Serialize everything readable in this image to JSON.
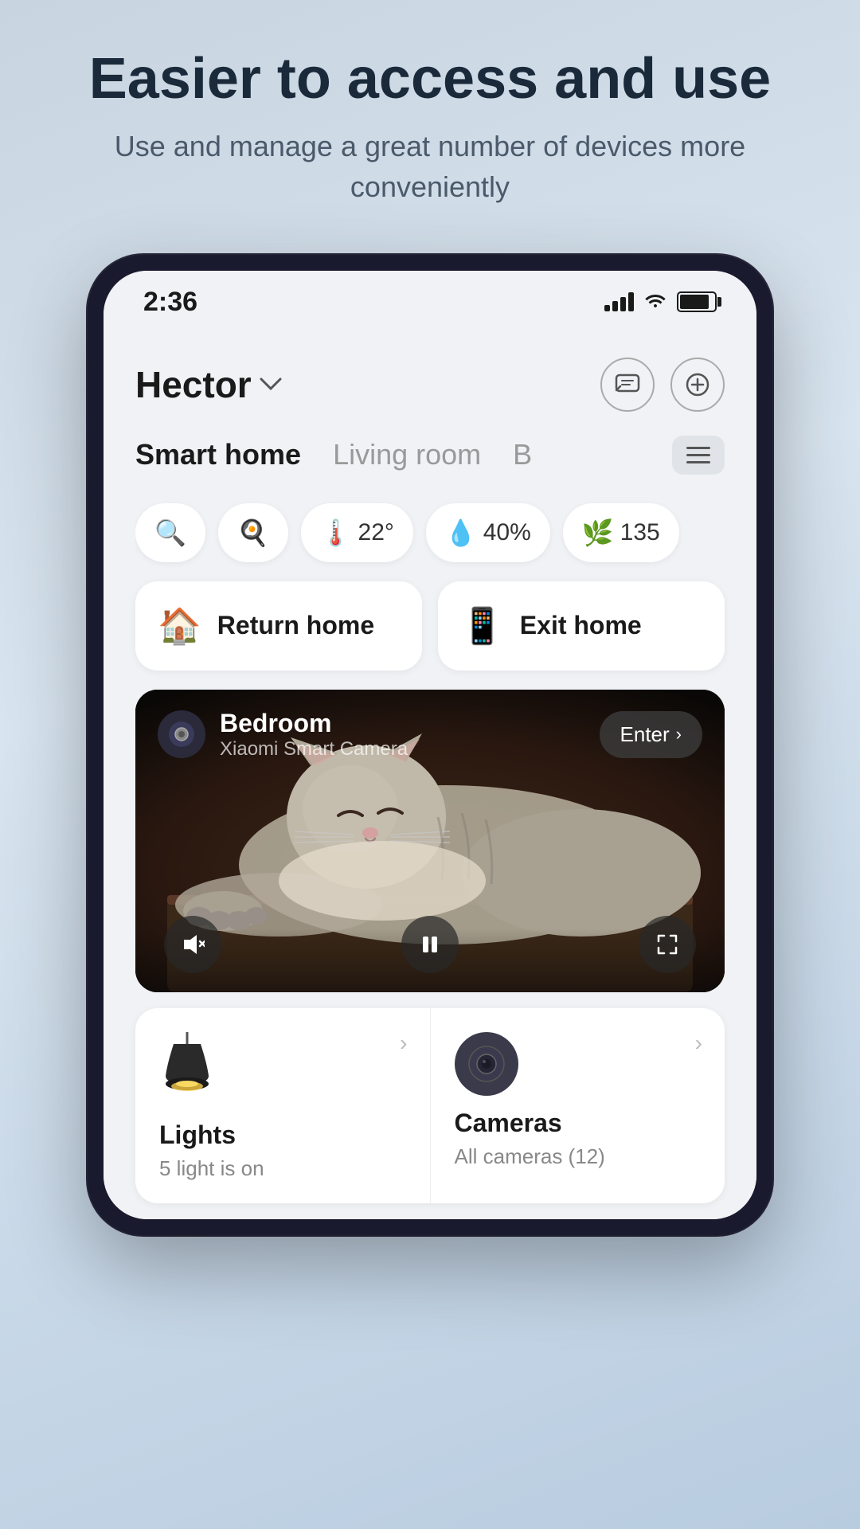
{
  "page": {
    "hero_title": "Easier to access and use",
    "hero_subtitle": "Use and manage a great number of devices more conveniently"
  },
  "status_bar": {
    "time": "2:36",
    "signal_bars": 4,
    "battery_pct": 85
  },
  "app_header": {
    "user_name": "Hector",
    "message_icon": "message-icon",
    "add_icon": "plus-icon"
  },
  "tabs": [
    {
      "label": "Smart home",
      "active": true
    },
    {
      "label": "Living room",
      "active": false
    },
    {
      "label": "B",
      "active": false
    }
  ],
  "status_chips": [
    {
      "icon": "🔍",
      "label": ""
    },
    {
      "icon": "🍳",
      "label": ""
    },
    {
      "icon": "🌡️",
      "value": "22°"
    },
    {
      "icon": "💧",
      "value": "40%"
    },
    {
      "icon": "🌿",
      "value": "135"
    }
  ],
  "actions": [
    {
      "id": "return_home",
      "icon": "🏠",
      "label": "Return home",
      "icon_color": "#f5a623"
    },
    {
      "id": "exit_home",
      "icon": "📱",
      "label": "Exit home",
      "icon_color": "#4a90d9"
    }
  ],
  "camera": {
    "room": "Bedroom",
    "device": "Xiaomi Smart Camera",
    "enter_label": "Enter"
  },
  "devices": [
    {
      "id": "lights",
      "name": "Lights",
      "status": "5 light is on"
    },
    {
      "id": "cameras",
      "name": "Cameras",
      "status": "All cameras (12)"
    }
  ]
}
